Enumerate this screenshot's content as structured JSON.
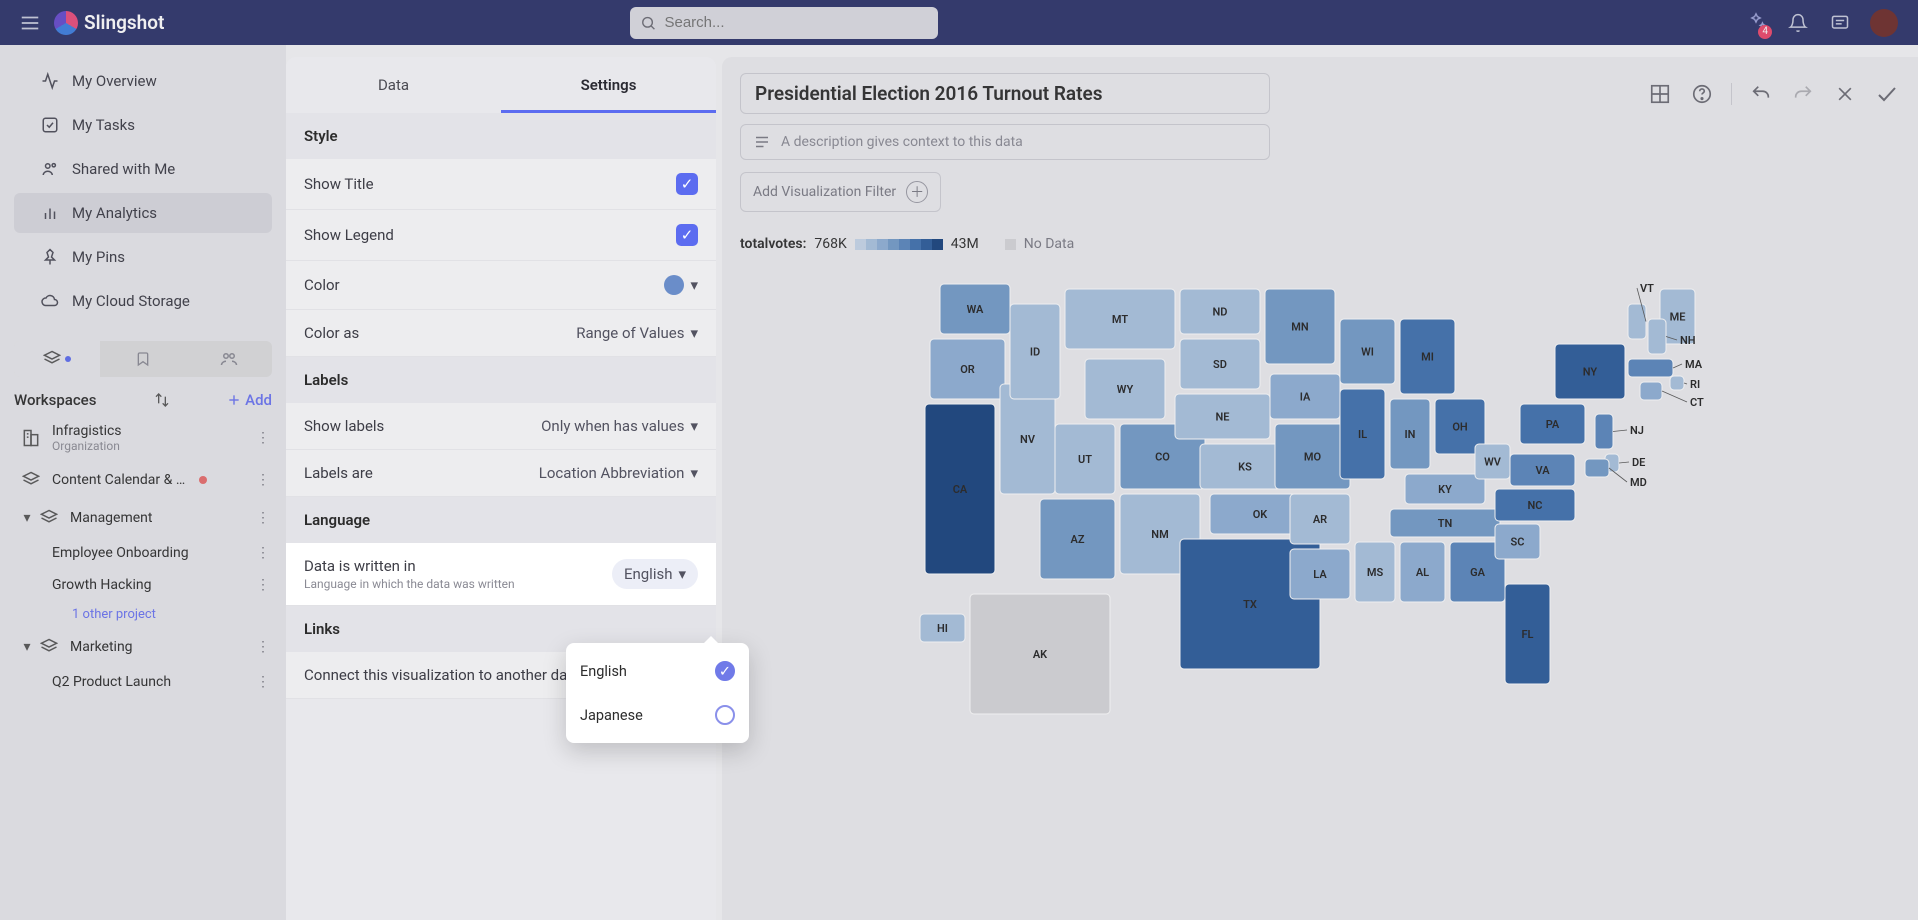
{
  "brand": "Slingshot",
  "search_placeholder": "Search...",
  "notification_count": "4",
  "nav": {
    "items": [
      {
        "label": "My Overview",
        "icon": "activity"
      },
      {
        "label": "My Tasks",
        "icon": "check-square"
      },
      {
        "label": "Shared with Me",
        "icon": "users"
      },
      {
        "label": "My Analytics",
        "icon": "bar-chart",
        "active": true
      },
      {
        "label": "My Pins",
        "icon": "pin"
      },
      {
        "label": "My Cloud Storage",
        "icon": "cloud"
      }
    ]
  },
  "workspace_header": "Workspaces",
  "add_label": "Add",
  "workspaces": {
    "org": {
      "name": "Infragistics",
      "sub": "Organization"
    },
    "items": [
      {
        "name": "Content Calendar & …",
        "dot": true
      },
      {
        "name": "Management",
        "expanded": true,
        "children": [
          {
            "name": "Employee Onboarding"
          },
          {
            "name": "Growth Hacking"
          }
        ],
        "more": "1 other project"
      },
      {
        "name": "Marketing",
        "expanded": true,
        "children": [
          {
            "name": "Q2 Product Launch"
          }
        ]
      }
    ]
  },
  "mid_tabs": {
    "data": "Data",
    "settings": "Settings"
  },
  "sections": {
    "style": "Style",
    "show_title": "Show Title",
    "show_legend": "Show Legend",
    "color": "Color",
    "color_as": "Color as",
    "color_as_val": "Range of Values",
    "labels": "Labels",
    "show_labels": "Show labels",
    "show_labels_val": "Only when has values",
    "labels_are": "Labels are",
    "labels_are_val": "Location Abbreviation",
    "language": "Language",
    "data_written": "Data is written in",
    "data_written_sub": "Language in which the data was written",
    "data_written_val": "English",
    "links": "Links",
    "connect": "Connect this visualization to another das"
  },
  "lang_options": [
    {
      "label": "English",
      "selected": true
    },
    {
      "label": "Japanese",
      "selected": false
    }
  ],
  "viz": {
    "title": "Presidential Election 2016 Turnout Rates",
    "desc_placeholder": "A description gives context to this data",
    "add_filter": "Add Visualization Filter",
    "legend_field": "totalvotes:",
    "legend_min": "768K",
    "legend_max": "43M",
    "no_data": "No Data"
  },
  "chart_data": {
    "type": "choropleth",
    "title": "Presidential Election 2016 Turnout Rates",
    "field": "totalvotes",
    "range": [
      768000,
      43000000
    ],
    "color_ramp": [
      "#c6d7ea",
      "#a9c3e0",
      "#8fb0d6",
      "#729bc9",
      "#5886bd",
      "#3e70af",
      "#2a5a9a",
      "#16417e"
    ],
    "no_data_color": "#d6d6da",
    "states": [
      {
        "abbr": "WA",
        "shade": 3
      },
      {
        "abbr": "OR",
        "shade": 2
      },
      {
        "abbr": "CA",
        "shade": 7
      },
      {
        "abbr": "NV",
        "shade": 1
      },
      {
        "abbr": "ID",
        "shade": 1
      },
      {
        "abbr": "MT",
        "shade": 1
      },
      {
        "abbr": "WY",
        "shade": 1
      },
      {
        "abbr": "UT",
        "shade": 1
      },
      {
        "abbr": "AZ",
        "shade": 3
      },
      {
        "abbr": "CO",
        "shade": 3
      },
      {
        "abbr": "NM",
        "shade": 1
      },
      {
        "abbr": "ND",
        "shade": 1
      },
      {
        "abbr": "SD",
        "shade": 1
      },
      {
        "abbr": "NE",
        "shade": 1
      },
      {
        "abbr": "KS",
        "shade": 1
      },
      {
        "abbr": "OK",
        "shade": 2
      },
      {
        "abbr": "TX",
        "shade": 6
      },
      {
        "abbr": "MN",
        "shade": 3
      },
      {
        "abbr": "IA",
        "shade": 2
      },
      {
        "abbr": "MO",
        "shade": 3
      },
      {
        "abbr": "AR",
        "shade": 1
      },
      {
        "abbr": "LA",
        "shade": 2
      },
      {
        "abbr": "WI",
        "shade": 3
      },
      {
        "abbr": "IL",
        "shade": 5
      },
      {
        "abbr": "MI",
        "shade": 5
      },
      {
        "abbr": "IN",
        "shade": 3
      },
      {
        "abbr": "OH",
        "shade": 5
      },
      {
        "abbr": "KY",
        "shade": 2
      },
      {
        "abbr": "TN",
        "shade": 3
      },
      {
        "abbr": "MS",
        "shade": 1
      },
      {
        "abbr": "AL",
        "shade": 2
      },
      {
        "abbr": "GA",
        "shade": 4
      },
      {
        "abbr": "FL",
        "shade": 6
      },
      {
        "abbr": "SC",
        "shade": 2
      },
      {
        "abbr": "NC",
        "shade": 5
      },
      {
        "abbr": "VA",
        "shade": 4
      },
      {
        "abbr": "WV",
        "shade": 1
      },
      {
        "abbr": "PA",
        "shade": 5
      },
      {
        "abbr": "NY",
        "shade": 6
      },
      {
        "abbr": "ME",
        "shade": 1
      },
      {
        "abbr": "VT",
        "shade": 1
      },
      {
        "abbr": "NH",
        "shade": 1
      },
      {
        "abbr": "MA",
        "shade": 4
      },
      {
        "abbr": "RI",
        "shade": 1
      },
      {
        "abbr": "CT",
        "shade": 2
      },
      {
        "abbr": "NJ",
        "shade": 4
      },
      {
        "abbr": "DE",
        "shade": 1
      },
      {
        "abbr": "MD",
        "shade": 3
      },
      {
        "abbr": "AK",
        "shade": null
      },
      {
        "abbr": "HI",
        "shade": 1
      }
    ]
  }
}
